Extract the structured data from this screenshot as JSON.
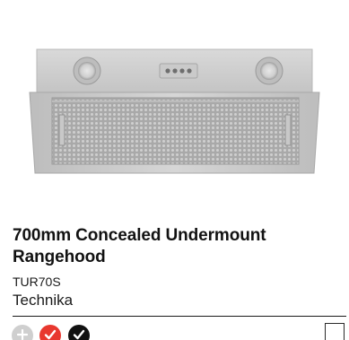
{
  "product": {
    "title": "700mm Concealed Undermount Rangehood",
    "model": "TUR70S",
    "brand": "Technika",
    "image_icon": "rangehood-image"
  },
  "swatches": [
    {
      "name": "add-option",
      "color": "#cfcfcf",
      "icon": "plus-icon"
    },
    {
      "name": "red-selected",
      "color": "#e8382f",
      "icon": "check-icon"
    },
    {
      "name": "black-selected",
      "color": "#111111",
      "icon": "check-icon"
    }
  ],
  "colors": {
    "steel": "#c9c9c9",
    "accent_red": "#e8382f",
    "text": "#121212"
  }
}
